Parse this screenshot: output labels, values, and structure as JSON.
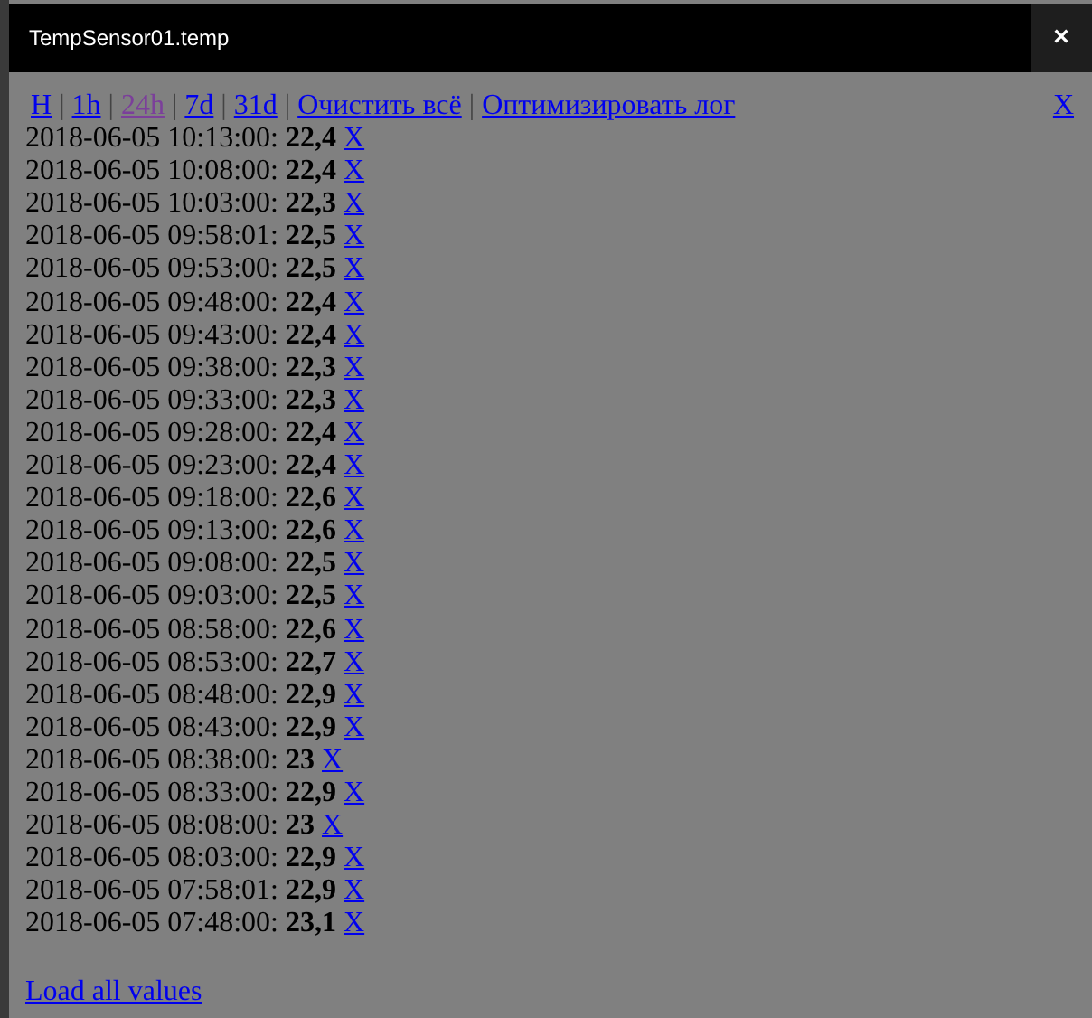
{
  "window": {
    "title": "TempSensor01.temp",
    "close": "×"
  },
  "nav": {
    "links": [
      {
        "label": "H",
        "visited": false
      },
      {
        "label": "1h",
        "visited": false
      },
      {
        "label": "24h",
        "visited": true
      },
      {
        "label": "7d",
        "visited": false
      },
      {
        "label": "31d",
        "visited": false
      },
      {
        "label": "Очистить всё",
        "visited": false
      },
      {
        "label": "Оптимизировать лог",
        "visited": false
      }
    ],
    "separator": "|",
    "close": "X"
  },
  "rows": [
    {
      "time": "2018-06-05 10:13:00:",
      "value": "22,4",
      "delete": "X"
    },
    {
      "time": "2018-06-05 10:08:00:",
      "value": "22,4",
      "delete": "X"
    },
    {
      "time": "2018-06-05 10:03:00:",
      "value": "22,3",
      "delete": "X"
    },
    {
      "time": "2018-06-05 09:58:01:",
      "value": "22,5",
      "delete": "X"
    },
    {
      "time": "2018-06-05 09:53:00:",
      "value": "22,5",
      "delete": "X"
    },
    {
      "time": "2018-06-05 09:48:00:",
      "value": "22,4",
      "delete": "X"
    },
    {
      "time": "2018-06-05 09:43:00:",
      "value": "22,4",
      "delete": "X"
    },
    {
      "time": "2018-06-05 09:38:00:",
      "value": "22,3",
      "delete": "X"
    },
    {
      "time": "2018-06-05 09:33:00:",
      "value": "22,3",
      "delete": "X"
    },
    {
      "time": "2018-06-05 09:28:00:",
      "value": "22,4",
      "delete": "X"
    },
    {
      "time": "2018-06-05 09:23:00:",
      "value": "22,4",
      "delete": "X"
    },
    {
      "time": "2018-06-05 09:18:00:",
      "value": "22,6",
      "delete": "X"
    },
    {
      "time": "2018-06-05 09:13:00:",
      "value": "22,6",
      "delete": "X"
    },
    {
      "time": "2018-06-05 09:08:00:",
      "value": "22,5",
      "delete": "X"
    },
    {
      "time": "2018-06-05 09:03:00:",
      "value": "22,5",
      "delete": "X"
    },
    {
      "time": "2018-06-05 08:58:00:",
      "value": "22,6",
      "delete": "X"
    },
    {
      "time": "2018-06-05 08:53:00:",
      "value": "22,7",
      "delete": "X"
    },
    {
      "time": "2018-06-05 08:48:00:",
      "value": "22,9",
      "delete": "X"
    },
    {
      "time": "2018-06-05 08:43:00:",
      "value": "22,9",
      "delete": "X"
    },
    {
      "time": "2018-06-05 08:38:00:",
      "value": "23",
      "delete": "X"
    },
    {
      "time": "2018-06-05 08:33:00:",
      "value": "22,9",
      "delete": "X"
    },
    {
      "time": "2018-06-05 08:08:00:",
      "value": "23",
      "delete": "X"
    },
    {
      "time": "2018-06-05 08:03:00:",
      "value": "22,9",
      "delete": "X"
    },
    {
      "time": "2018-06-05 07:58:01:",
      "value": "22,9",
      "delete": "X"
    },
    {
      "time": "2018-06-05 07:48:00:",
      "value": "23,1",
      "delete": "X"
    }
  ],
  "load_all": "Load all values"
}
